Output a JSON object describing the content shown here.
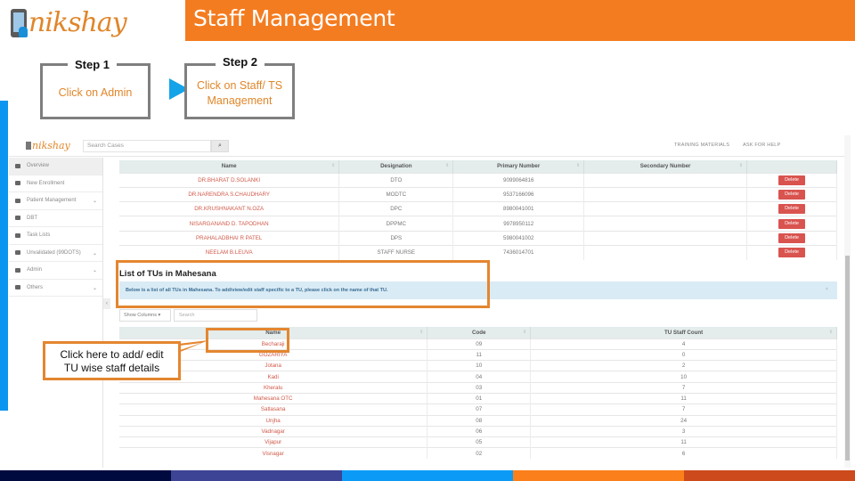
{
  "slide": {
    "logo_text": "nikshay",
    "title": "Staff Management",
    "step1": {
      "label": "Step 1",
      "text": "Click on Admin"
    },
    "step2": {
      "label": "Step 2",
      "text_line1": "Click on Staff/ TS",
      "text_line2": "Management"
    },
    "callout": {
      "line1": "Click here to add/ edit",
      "line2": "TU wise staff details"
    },
    "colors": {
      "accent_orange": "#f47c20",
      "highlight_orange": "#e4862f",
      "arrow_blue": "#14a3e8",
      "bottom_bar": [
        "#000a3f",
        "#3d4495",
        "#0b9af5",
        "#fb7f1a",
        "#cc4a1c"
      ]
    }
  },
  "app": {
    "logo_text": "nikshay",
    "search_placeholder": "Search Cases",
    "search_icon": "search-icon",
    "top_links": [
      "TRAINING MATERIALS",
      "ASK FOR HELP"
    ],
    "sidebar": [
      {
        "label": "Overview",
        "icon": "dashboard-icon",
        "chevron": false,
        "active": true
      },
      {
        "label": "New Enrollment",
        "icon": "plus-icon",
        "chevron": false
      },
      {
        "label": "Patient Management",
        "icon": "folder-icon",
        "chevron": true
      },
      {
        "label": "DBT",
        "icon": "money-icon",
        "chevron": false
      },
      {
        "label": "Task Lists",
        "icon": "list-icon",
        "chevron": false
      },
      {
        "label": "Unvalidated (99DOTS)",
        "icon": "warning-icon",
        "chevron": true
      },
      {
        "label": "Admin",
        "icon": "user-icon",
        "chevron": true
      },
      {
        "label": "Others",
        "icon": "box-icon",
        "chevron": true
      }
    ],
    "staff_table": {
      "columns": [
        "Name",
        "Designation",
        "Primary Number",
        "Secondary Number",
        ""
      ],
      "delete_label": "Delete",
      "rows": [
        {
          "name": "DR.BHARAT D.SOLANKI",
          "designation": "DTO",
          "primary": "9099064816",
          "secondary": ""
        },
        {
          "name": "DR.NARENDRA S.CHAUDHARY",
          "designation": "MODTC",
          "primary": "9537166096",
          "secondary": ""
        },
        {
          "name": "DR.KRUSHNAKANT N.OZA",
          "designation": "DPC",
          "primary": "8980041001",
          "secondary": ""
        },
        {
          "name": "NISARGANAND D. TAPODHAN",
          "designation": "DPPMC",
          "primary": "9978950112",
          "secondary": ""
        },
        {
          "name": "PRAHALADBHAI R PATEL",
          "designation": "DPS",
          "primary": "5980041002",
          "secondary": ""
        },
        {
          "name": "NEELAM B.LEUVA",
          "designation": "STAFF NURSE",
          "primary": "7436014701",
          "secondary": ""
        }
      ]
    },
    "tu_section": {
      "title": "List of TUs in Mahesana",
      "info": "Below is a list of all TUs in Mahesana. To add/view/edit staff specific to a TU, please click on the name of that TU.",
      "show_columns_label": "Show Columns ▾",
      "search_placeholder": "Search",
      "columns": [
        "Name",
        "Code",
        "TU Staff Count"
      ],
      "rows": [
        {
          "name": "Becharaji",
          "code": "09",
          "count": "4"
        },
        {
          "name": "GOZARIYA",
          "code": "11",
          "count": "0"
        },
        {
          "name": "Jotana",
          "code": "10",
          "count": "2"
        },
        {
          "name": "Kadi",
          "code": "04",
          "count": "10"
        },
        {
          "name": "Kheralu",
          "code": "03",
          "count": "7"
        },
        {
          "name": "Mahesana OTC",
          "code": "01",
          "count": "11"
        },
        {
          "name": "Satlasana",
          "code": "07",
          "count": "7"
        },
        {
          "name": "Unjha",
          "code": "08",
          "count": "24"
        },
        {
          "name": "Vadnagar",
          "code": "06",
          "count": "3"
        },
        {
          "name": "Vijapur",
          "code": "05",
          "count": "11"
        },
        {
          "name": "Visnagar",
          "code": "02",
          "count": "6"
        }
      ]
    }
  }
}
